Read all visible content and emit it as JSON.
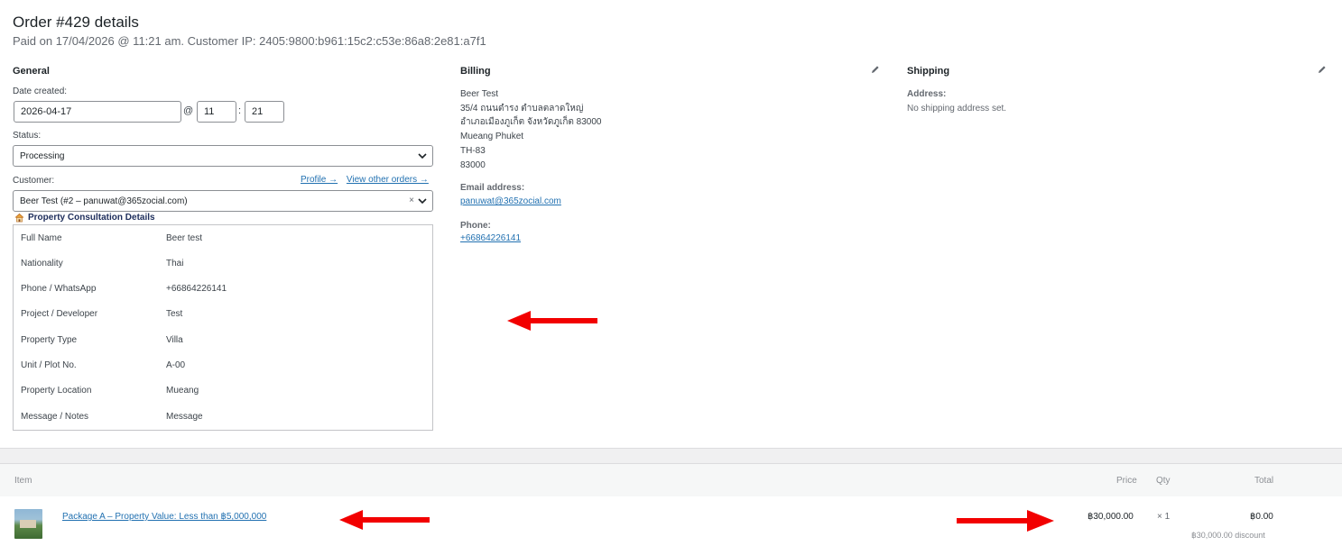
{
  "order": {
    "title": "Order #429 details",
    "meta": "Paid on 17/04/2026 @ 11:21 am. Customer IP: 2405:9800:b961:15c2:c53e:86a8:2e81:a7f1"
  },
  "general": {
    "heading": "General",
    "date_label": "Date created:",
    "date_value": "2026-04-17",
    "at": "@",
    "hour": "11",
    "colon": ":",
    "minute": "21",
    "status_label": "Status:",
    "status_value": "Processing",
    "customer_label": "Customer:",
    "profile_link": "Profile →",
    "view_orders_link": "View other orders →",
    "customer_value": "Beer Test (#2 – panuwat@365zocial.com)",
    "clear_symbol": "×"
  },
  "consultation": {
    "title": "Property Consultation Details",
    "rows": [
      {
        "key": "Full Name",
        "value": "Beer test"
      },
      {
        "key": "Nationality",
        "value": "Thai"
      },
      {
        "key": "Phone / WhatsApp",
        "value": "+66864226141"
      },
      {
        "key": "Project / Developer",
        "value": "Test"
      },
      {
        "key": "Property Type",
        "value": "Villa"
      },
      {
        "key": "Unit / Plot No.",
        "value": "A-00"
      },
      {
        "key": "Property Location",
        "value": "Mueang"
      },
      {
        "key": "Message / Notes",
        "value": "Message"
      }
    ]
  },
  "billing": {
    "heading": "Billing",
    "address_lines": [
      "Beer Test",
      "35/4 ถนนดำรง ตำบลตลาดใหญ่",
      "อำเภอเมืองภูเก็ต จังหวัดภูเก็ต 83000",
      "Mueang Phuket",
      "TH-83",
      "83000"
    ],
    "email_label": "Email address:",
    "email": "panuwat@365zocial.com",
    "phone_label": "Phone:",
    "phone": "+66864226141"
  },
  "shipping": {
    "heading": "Shipping",
    "address_label": "Address:",
    "address_value": "No shipping address set."
  },
  "items": {
    "headers": {
      "item": "Item",
      "price": "Price",
      "qty": "Qty",
      "total": "Total"
    },
    "rows": [
      {
        "name": "Package A – Property Value: Less than ฿5,000,000",
        "price": "฿30,000.00",
        "qty": "× 1",
        "total": "฿0.00",
        "discount": "฿30,000.00 discount"
      }
    ]
  },
  "colors": {
    "link": "#2271b1",
    "annotation_arrow": "#f20000",
    "heading_navy": "#1d2d5b"
  }
}
